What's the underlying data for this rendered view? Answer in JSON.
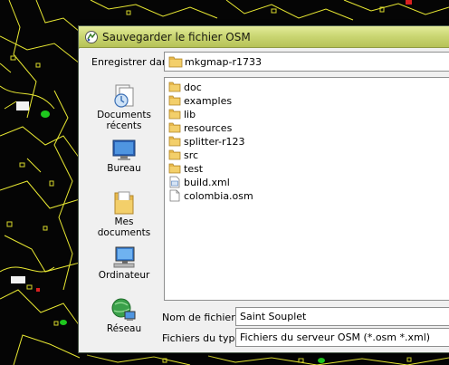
{
  "window": {
    "title": "Sauvegarder le fichier OSM"
  },
  "location": {
    "label": "Enregistrer dans :",
    "value": "mkgmap-r1733"
  },
  "places": [
    {
      "label": "Documents récents",
      "icon": "recent-documents-icon"
    },
    {
      "label": "Bureau",
      "icon": "desktop-icon"
    },
    {
      "label": "Mes documents",
      "icon": "my-documents-icon"
    },
    {
      "label": "Ordinateur",
      "icon": "computer-icon"
    },
    {
      "label": "Réseau",
      "icon": "network-icon"
    }
  ],
  "files": [
    {
      "name": "doc",
      "type": "folder"
    },
    {
      "name": "examples",
      "type": "folder"
    },
    {
      "name": "lib",
      "type": "folder"
    },
    {
      "name": "resources",
      "type": "folder"
    },
    {
      "name": "splitter-r123",
      "type": "folder"
    },
    {
      "name": "src",
      "type": "folder"
    },
    {
      "name": "test",
      "type": "folder"
    },
    {
      "name": "build.xml",
      "type": "xml-file"
    },
    {
      "name": "colombia.osm",
      "type": "file"
    }
  ],
  "filename": {
    "label": "Nom de fichier :",
    "value": "Saint Souplet"
  },
  "filetype": {
    "label": "Fichiers du type :",
    "value": "Fichiers du serveur OSM (*.osm *.xml)"
  },
  "colors": {
    "titlebar": "#cbd774",
    "map_roads": "#e8e832",
    "folder": "#e8b84a"
  }
}
